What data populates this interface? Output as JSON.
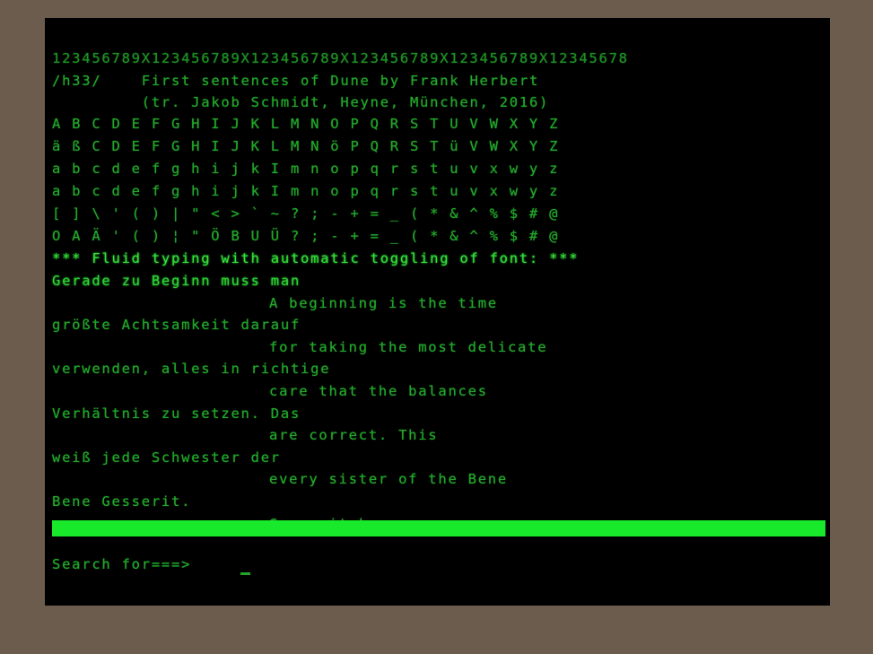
{
  "window": {
    "title": "terminal",
    "background_color": "#000000",
    "desktop_color": "#6b5c4e",
    "text_color": "#1f9b26",
    "highlight_color": "#18e92a"
  },
  "screen": {
    "ruler": "123456789X123456789X123456789X123456789X123456789X12345678",
    "header": {
      "tag": "/h33/",
      "title": "First sentences of Dune by Frank Herbert",
      "credit": "(tr. Jakob Schmidt, Heyne, München, 2016)"
    },
    "charset_rows": [
      "A B C D E F G H I J K L M N O P Q R S T U V W X Y Z",
      "ä ß C D E F G H I J K L M N ö P Q R S T ü V W X Y Z",
      "a b c d e f g h i j k I m n o p q r s t u v x w y z",
      "a b c d e f g h i j k I m n o p q r s t u v x w y z",
      "[ ] \\ ' ( ) | \" < > ` ~ ? ; - + = _ ( * & ^ % $ # @",
      "O A Ä ' ( ) ¦ \" Ö B U Ü ? ; - + = _ ( * & ^ % $ # @"
    ],
    "banner": "*** Fluid typing with automatic toggling of font: ***",
    "body_lines": [
      {
        "text": "Gerade zu Beginn muss man",
        "indent": 0,
        "style": "bright"
      },
      {
        "text": "A beginning is the time",
        "indent": 22,
        "style": "mid"
      },
      {
        "text": "größte Achtsamkeit darauf",
        "indent": 0,
        "style": "mid"
      },
      {
        "text": "for taking the most delicate",
        "indent": 22,
        "style": "mid"
      },
      {
        "text": "verwenden, alles in richtige",
        "indent": 0,
        "style": "mid"
      },
      {
        "text": "care that the balances",
        "indent": 22,
        "style": "mid"
      },
      {
        "text": "Verhältnis zu setzen. Das",
        "indent": 0,
        "style": "mid"
      },
      {
        "text": "are correct. This",
        "indent": 22,
        "style": "mid"
      },
      {
        "text": "weiß jede Schwester der",
        "indent": 0,
        "style": "mid"
      },
      {
        "text": "every sister of the Bene",
        "indent": 22,
        "style": "mid"
      },
      {
        "text": "Bene Gesserit.",
        "indent": 0,
        "style": "mid"
      },
      {
        "text": "Gesserit knows.",
        "indent": 22,
        "style": "mid"
      }
    ]
  },
  "prompt": {
    "label": "Search for===>",
    "value": "",
    "placeholder": ""
  }
}
